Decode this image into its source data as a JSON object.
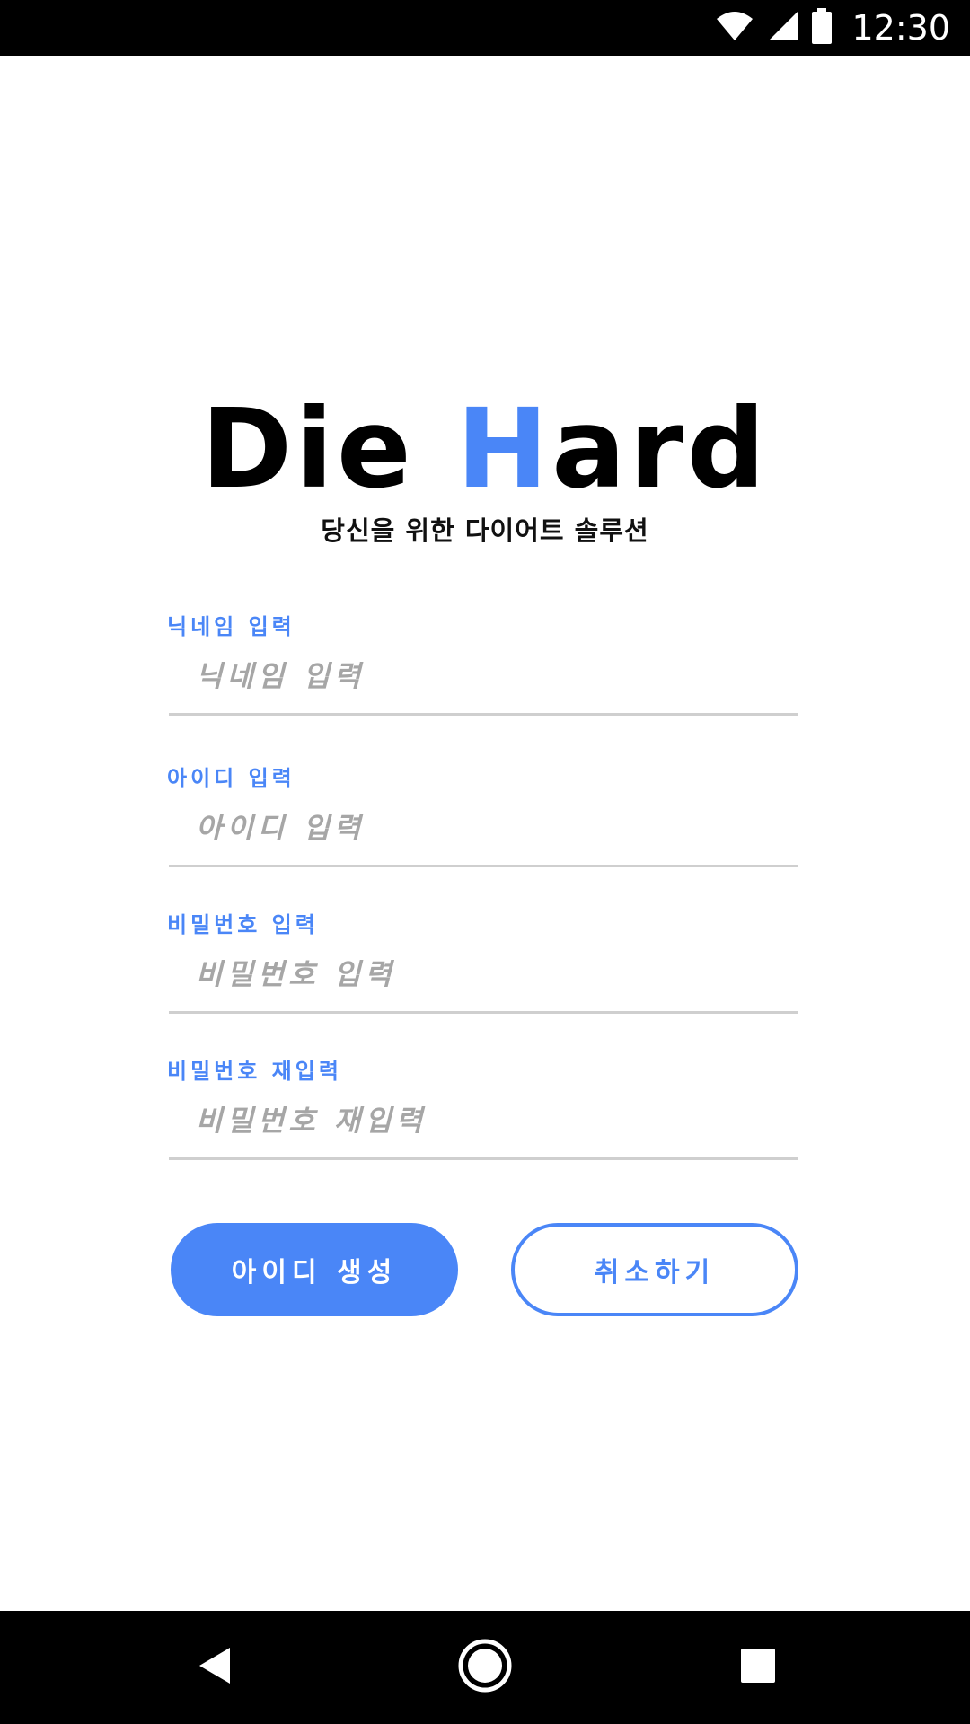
{
  "status_bar": {
    "time": "12:30",
    "icons": [
      "wifi-icon",
      "cell-signal-icon",
      "battery-icon"
    ]
  },
  "logo": {
    "part1": "Die ",
    "accent": "H",
    "part2": "ard",
    "accent_color": "#4a86f7"
  },
  "tagline": "당신을 위한 다이어트 솔루션",
  "form": {
    "nickname": {
      "label": "닉네임 입력",
      "placeholder": "닉네임 입력",
      "value": ""
    },
    "user_id": {
      "label": "아이디 입력",
      "placeholder": "아이디 입력",
      "value": ""
    },
    "password": {
      "label": "비밀번호 입력",
      "placeholder": "비밀번호 입력",
      "value": ""
    },
    "password_confirm": {
      "label": "비밀번호 재입력",
      "placeholder": "비밀번호 재입력",
      "value": ""
    }
  },
  "buttons": {
    "create": "아이디 생성",
    "cancel": "취소하기"
  },
  "nav_bar": {
    "icons": [
      "back-icon",
      "home-icon",
      "recents-icon"
    ]
  },
  "colors": {
    "accent": "#4a86f7",
    "status_bar": "#000000",
    "nav_bar": "#000000",
    "placeholder": "#a6a6a6",
    "underline": "#cfcfcf"
  }
}
